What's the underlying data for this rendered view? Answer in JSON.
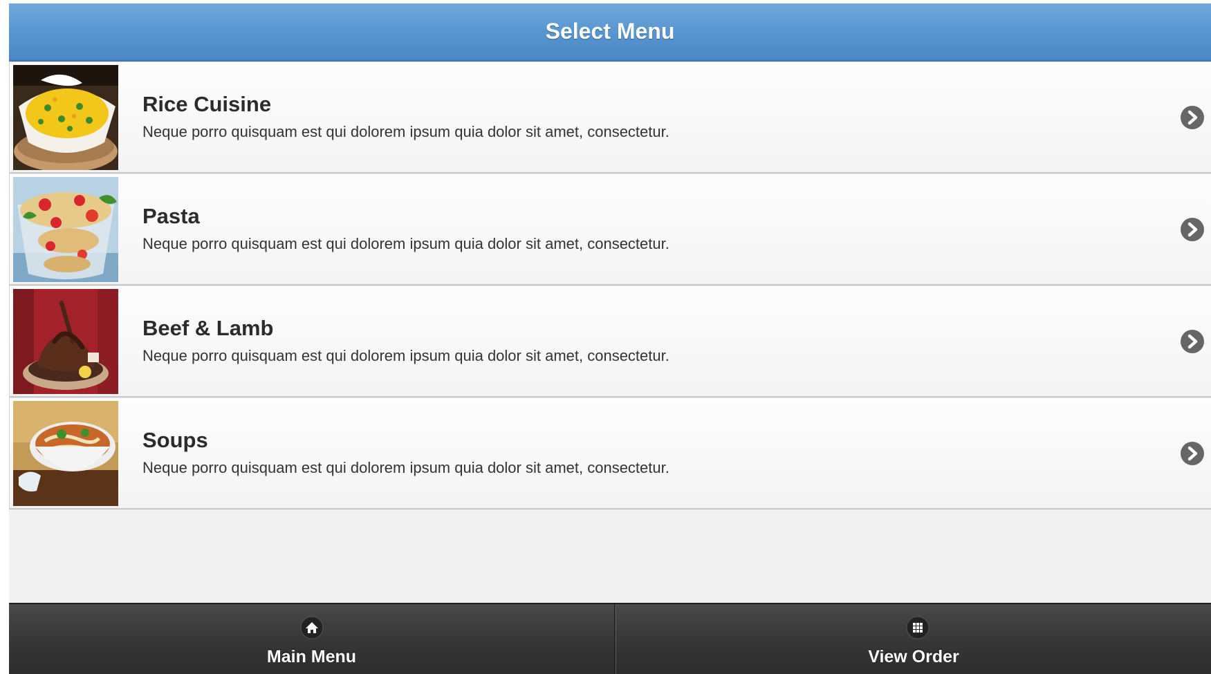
{
  "header": {
    "title": "Select Menu"
  },
  "menu": {
    "items": [
      {
        "title": "Rice Cuisine",
        "description": "Neque porro quisquam est qui dolorem ipsum quia dolor sit amet, consectetur.",
        "thumbnail": "rice-dish-photo",
        "chevron_icon": "chevron-right-circle-icon"
      },
      {
        "title": "Pasta",
        "description": "Neque porro quisquam est qui dolorem ipsum quia dolor sit amet, consectetur.",
        "thumbnail": "pasta-salad-photo",
        "chevron_icon": "chevron-right-circle-icon"
      },
      {
        "title": "Beef & Lamb",
        "description": "Neque porro quisquam est qui dolorem ipsum quia dolor sit amet, consectetur.",
        "thumbnail": "roast-meat-photo",
        "chevron_icon": "chevron-right-circle-icon"
      },
      {
        "title": "Soups",
        "description": "Neque porro quisquam est qui dolorem ipsum quia dolor sit amet, consectetur.",
        "thumbnail": "noodle-soup-photo",
        "chevron_icon": "chevron-right-circle-icon"
      }
    ]
  },
  "footer": {
    "main_menu_label": "Main Menu",
    "main_menu_icon": "home-icon",
    "view_order_label": "View Order",
    "view_order_icon": "grid-icon"
  },
  "colors": {
    "header_gradient_top": "#72a9dc",
    "header_gradient_bottom": "#4a86c4",
    "footer_bg": "#333333",
    "page_bg": "#f1f1f1"
  }
}
